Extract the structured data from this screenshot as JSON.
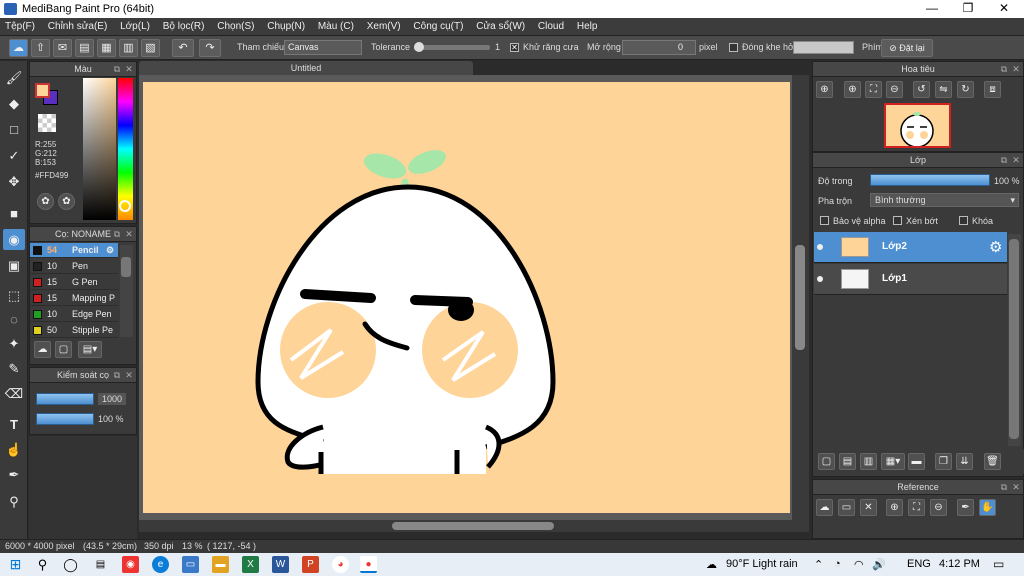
{
  "window": {
    "title": "MediBang Paint Pro (64bit)",
    "min": "—",
    "max": "❐",
    "close": "✕"
  },
  "menu": [
    "Tệp(F)",
    "Chỉnh sửa(E)",
    "Lớp(L)",
    "Bộ lọc(R)",
    "Chọn(S)",
    "Chụp(N)",
    "Màu (C)",
    "Xem(V)",
    "Công cụ(T)",
    "Cửa sổ(W)",
    "Cloud",
    "Help"
  ],
  "toolbar": {
    "reference_label": "Tham chiếu",
    "reference_value": "Canvas",
    "tolerance_label": "Tolerance",
    "tolerance_value": "1",
    "tolerance_fraction": 0.02,
    "antialias_label": "Khử răng cưa",
    "antialias_checked": "✕",
    "expand_label": "Mở rộng",
    "expand_value": "0",
    "expand_unit": "pixel",
    "gap_label": "Đóng khe hở",
    "key_label": "Phím",
    "reset_label": "Đặt lại"
  },
  "color_panel": {
    "title": "Màu",
    "r": "R:255",
    "g": "G:212",
    "b": "B:153",
    "hex": "#FFD499",
    "fg": "#ffd499",
    "bg": "#5a2fc0"
  },
  "brush_panel": {
    "title": "Cọ: NONAME",
    "items": [
      {
        "size": "54",
        "name": "Pencil",
        "color": "#111111"
      },
      {
        "size": "10",
        "name": "Pen",
        "color": "#222222"
      },
      {
        "size": "15",
        "name": "G Pen",
        "color": "#d02020"
      },
      {
        "size": "15",
        "name": "Mapping P",
        "color": "#d02020"
      },
      {
        "size": "10",
        "name": "Edge Pen",
        "color": "#20a020"
      },
      {
        "size": "50",
        "name": "Stipple Pe",
        "color": "#e0d020"
      }
    ]
  },
  "brush_control": {
    "title": "Kiểm soát cọ",
    "size_value": "1000",
    "opacity_value": "100 %"
  },
  "canvas_tab": "Untitled",
  "navigator": {
    "title": "Hoa tiêu"
  },
  "layer_panel": {
    "title": "Lớp",
    "opacity_label": "Độ trong",
    "opacity_value": "100 %",
    "opacity_fraction": 1.0,
    "blend_label": "Pha trộn",
    "blend_value": "Bình thường",
    "protect_alpha": "Bảo vệ alpha",
    "clipping": "Xén bớt",
    "lock": "Khóa",
    "layers": [
      {
        "name": "Lớp2",
        "selected": true
      },
      {
        "name": "Lớp1",
        "selected": false
      }
    ]
  },
  "reference_panel": {
    "title": "Reference"
  },
  "status": {
    "size": "6000 * 4000 pixel",
    "physical": "(43.5 * 29cm)",
    "dpi": "350 dpi",
    "zoom": "13 %",
    "coords": "( 1217, -54 )"
  },
  "taskbar": {
    "weather": "90°F  Light rain",
    "lang": "ENG",
    "time": "4:12 PM"
  },
  "colors": {
    "accent": "#4d8fd0",
    "canvas_bg": "#ffd499",
    "cheek": "#ffd499"
  }
}
